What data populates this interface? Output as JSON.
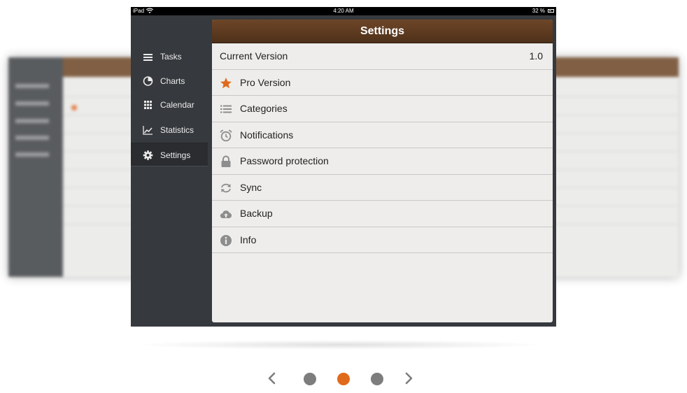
{
  "status_bar": {
    "carrier": "iPad",
    "time": "4:20 AM",
    "battery": "32 %"
  },
  "sidebar": {
    "items": [
      {
        "label": "Tasks",
        "icon": "list-icon"
      },
      {
        "label": "Charts",
        "icon": "pie-chart-icon"
      },
      {
        "label": "Calendar",
        "icon": "calendar-grid-icon"
      },
      {
        "label": "Statistics",
        "icon": "trend-line-icon"
      },
      {
        "label": "Settings",
        "icon": "gear-icon",
        "active": true
      }
    ]
  },
  "settings": {
    "title": "Settings",
    "rows": [
      {
        "label": "Current Version",
        "value": "1.0"
      },
      {
        "label": "Pro Version",
        "icon": "star-icon"
      },
      {
        "label": "Categories",
        "icon": "list-icon"
      },
      {
        "label": "Notifications",
        "icon": "alarm-clock-icon"
      },
      {
        "label": "Password protection",
        "icon": "lock-icon"
      },
      {
        "label": "Sync",
        "icon": "sync-icon"
      },
      {
        "label": "Backup",
        "icon": "cloud-upload-icon"
      },
      {
        "label": "Info",
        "icon": "info-icon"
      }
    ]
  },
  "pager": {
    "pages": 3,
    "current": 2
  },
  "colors": {
    "accent": "#e06a1c",
    "header_brown": "#5c3a1f",
    "sidebar_bg": "#36393d",
    "panel_bg": "#eeedeb"
  }
}
